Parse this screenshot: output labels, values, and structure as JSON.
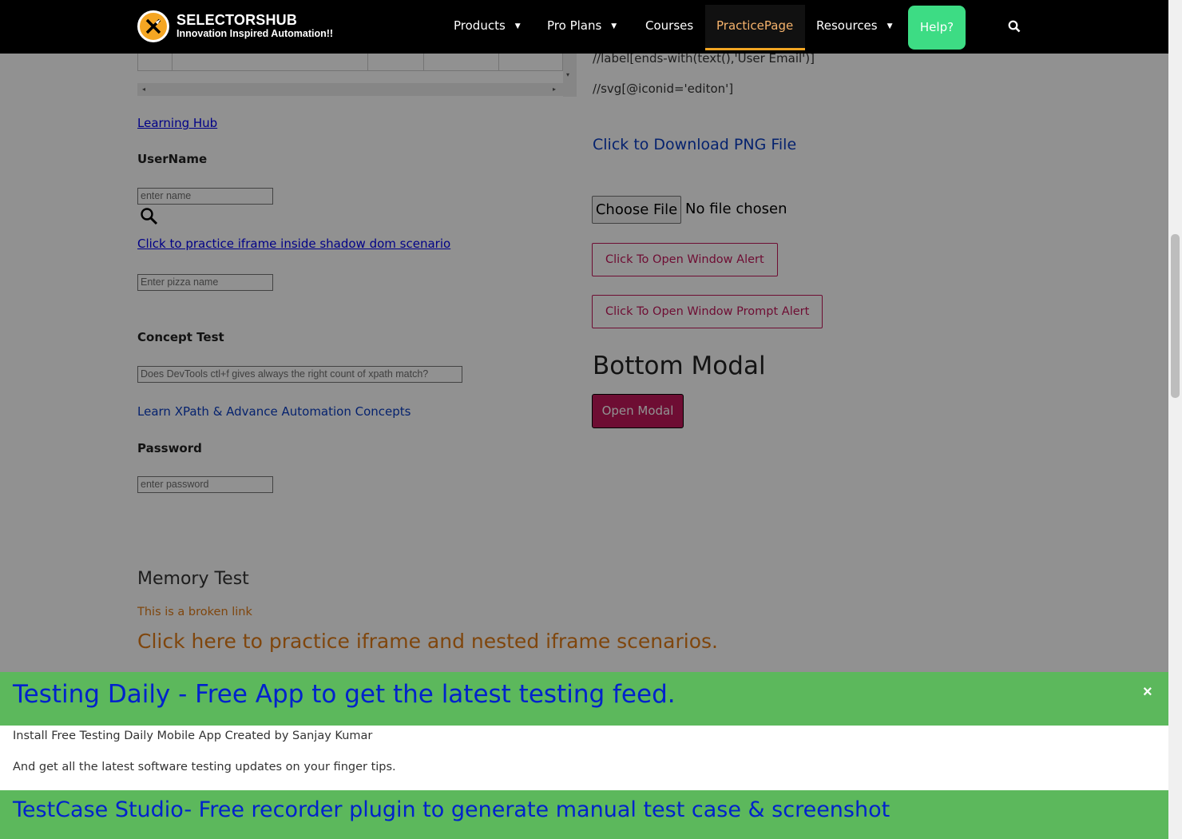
{
  "header": {
    "brand": "SELECTORSHUB",
    "tagline": "Innovation Inspired Automation!!",
    "nav": [
      {
        "label": "Products"
      },
      {
        "label": "Pro Plans"
      },
      {
        "label": "Courses"
      },
      {
        "label": "PracticePage"
      },
      {
        "label": "Resources"
      }
    ],
    "help_label": "Help?",
    "dropdown_caret": "▼",
    "search_icon": "search-icon"
  },
  "left": {
    "learning_hub": "Learning Hub",
    "username_label": "UserName",
    "username_placeholder": "enter name",
    "shadow_iframe_link": "Click to practice iframe inside shadow dom scenario",
    "pizza_placeholder": "Enter pizza name",
    "concept_label": "Concept Test",
    "concept_placeholder": "Does DevTools ctl+f gives always the right count of xpath match?",
    "learn_xpath_link": "Learn XPath & Advance Automation Concepts",
    "password_label": "Password",
    "password_placeholder": "enter password",
    "memory_heading": "Memory Test",
    "broken_link": "This is a broken link",
    "iframe_link": "Click here to practice iframe and nested iframe scenarios."
  },
  "right": {
    "xpath1": "//label[ends-with(text(),'User Email')]",
    "xpath2": "//svg[@iconid='editon']",
    "download_link": "Click to Download PNG File",
    "choose_file": "Choose File",
    "no_file": "No file chosen",
    "alert_button": "Click To Open Window Alert",
    "prompt_button": "Click To Open Window Prompt Alert",
    "bottom_modal_heading": "Bottom Modal",
    "open_modal_button": "Open Modal"
  },
  "modal": {
    "title": "Testing Daily - Free App to get the latest testing feed.",
    "close": "×",
    "line1": "Install Free Testing Daily Mobile App Created by Sanjay Kumar",
    "line2": "And get all the latest software testing updates on your finger tips.",
    "footer_title": "TestCase Studio- Free recorder plugin to generate manual test case & screenshot"
  },
  "colors": {
    "accent": "#f5a623",
    "help": "#3ddc84",
    "modal_green": "#5cb85c",
    "button_magenta": "#c2185b"
  }
}
